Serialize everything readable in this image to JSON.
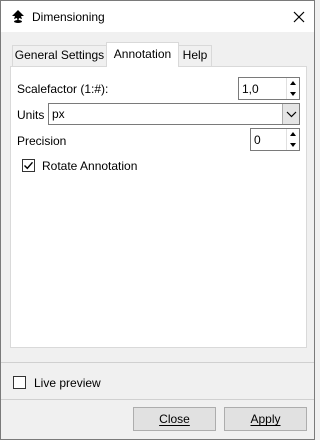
{
  "window": {
    "title": "Dimensioning",
    "icon": "inkscape-icon",
    "close_icon": "close-icon"
  },
  "tabs": [
    {
      "label": "General Settings",
      "active": false
    },
    {
      "label": "Annotation",
      "active": true
    },
    {
      "label": "Help",
      "active": false
    }
  ],
  "annotation": {
    "scalefactor_label": "Scalefactor (1:#):",
    "scalefactor_value": "1,0",
    "units_label": "Units",
    "units_value": "px",
    "precision_label": "Precision",
    "precision_value": "0",
    "rotate_label": "Rotate Annotation",
    "rotate_checked": true
  },
  "footer": {
    "live_preview_label": "Live preview",
    "live_preview_checked": false,
    "close_label": "Close",
    "apply_label": "Apply"
  }
}
